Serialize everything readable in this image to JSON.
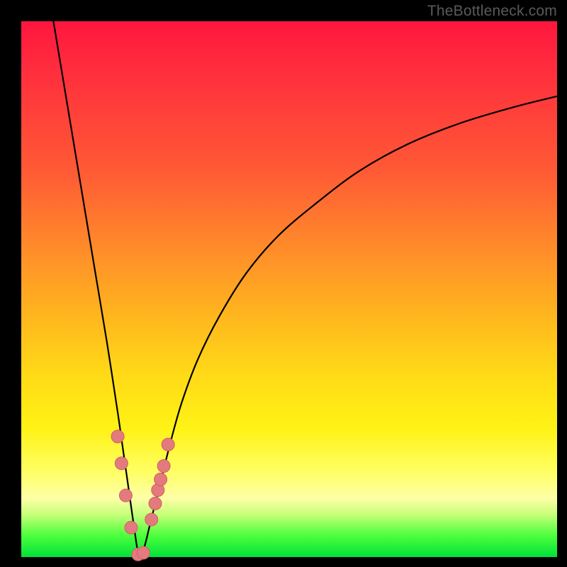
{
  "watermark": "TheBottleneck.com",
  "colors": {
    "frame": "#000000",
    "gradient_top": "#ff163e",
    "gradient_bottom": "#00e23a",
    "curve": "#000000",
    "dot_fill": "#e37b7e",
    "dot_stroke": "#d05f63"
  },
  "chart_data": {
    "type": "line",
    "title": "",
    "xlabel": "",
    "ylabel": "",
    "xlim": [
      0,
      100
    ],
    "ylim": [
      0,
      100
    ],
    "grid": false,
    "note": "Axes are unlabeled in the image; x and y are normalized 0–100. y increases upward (0 = bottom green band, 100 = top red). The curve is a sharp V-shaped dip reaching y≈0 near x≈22, with the left branch steep and the right branch rising asymptotically toward y≈88.",
    "series": [
      {
        "name": "bottleneck-curve",
        "x": [
          6,
          8,
          10,
          12,
          14,
          16,
          18,
          19,
          20,
          21,
          22,
          23,
          24,
          25,
          26,
          28,
          30,
          33,
          37,
          42,
          48,
          55,
          63,
          72,
          82,
          92,
          100
        ],
        "y": [
          100,
          88,
          76,
          64,
          52,
          40,
          27,
          20,
          13,
          6,
          0,
          2,
          6,
          10,
          14,
          22,
          29,
          37,
          45,
          53,
          60,
          66,
          72,
          77,
          81,
          84,
          86
        ]
      }
    ],
    "markers": {
      "name": "highlighted-points",
      "note": "Salmon dots clustered around the bottom of the V.",
      "x": [
        18.0,
        18.7,
        19.5,
        20.5,
        21.8,
        22.8,
        24.3,
        25.0,
        25.5,
        26.0,
        26.6,
        27.4
      ],
      "y": [
        22.5,
        17.5,
        11.5,
        5.5,
        0.5,
        0.8,
        7.0,
        10.0,
        12.5,
        14.5,
        17.0,
        21.0
      ]
    }
  }
}
